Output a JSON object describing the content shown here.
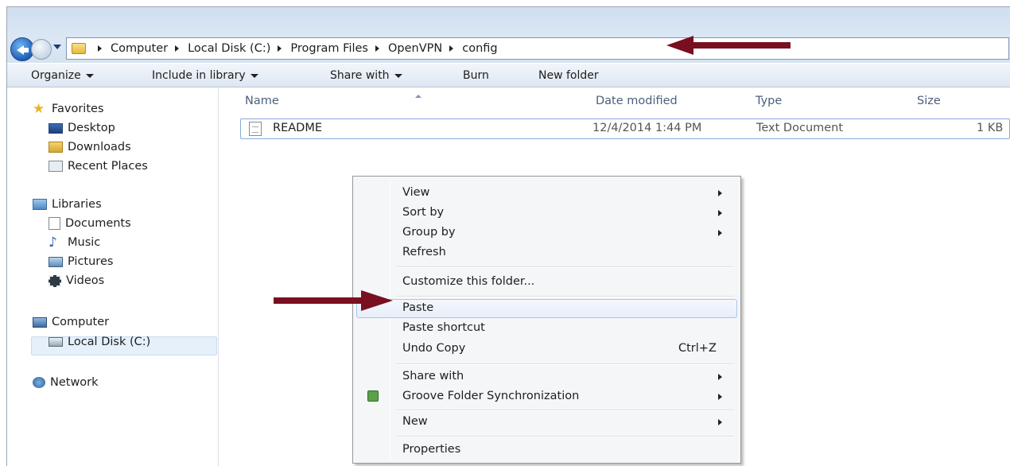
{
  "breadcrumb": [
    "Computer",
    "Local Disk (C:)",
    "Program Files",
    "OpenVPN",
    "config"
  ],
  "toolbar": {
    "organize": "Organize",
    "include_in_library": "Include in library",
    "share_with": "Share with",
    "burn": "Burn",
    "new_folder": "New folder"
  },
  "nav": {
    "favorites": "Favorites",
    "desktop": "Desktop",
    "downloads": "Downloads",
    "recent_places": "Recent Places",
    "libraries": "Libraries",
    "documents": "Documents",
    "music": "Music",
    "pictures": "Pictures",
    "videos": "Videos",
    "computer": "Computer",
    "local_disk": "Local Disk (C:)",
    "network": "Network"
  },
  "columns": {
    "name": "Name",
    "date_modified": "Date modified",
    "type": "Type",
    "size": "Size"
  },
  "file": {
    "name": "README",
    "date": "12/4/2014 1:44 PM",
    "type": "Text Document",
    "size": "1 KB"
  },
  "menu": {
    "view": "View",
    "sort_by": "Sort by",
    "group_by": "Group by",
    "refresh": "Refresh",
    "customize": "Customize this folder...",
    "paste": "Paste",
    "paste_shortcut": "Paste shortcut",
    "undo_copy": "Undo Copy",
    "undo_shortcut": "Ctrl+Z",
    "share_with": "Share with",
    "groove": "Groove Folder Synchronization",
    "new": "New",
    "properties": "Properties"
  },
  "colors": {
    "annotation_arrow": "#7a0f1f",
    "selection": "#e5f0fb"
  }
}
